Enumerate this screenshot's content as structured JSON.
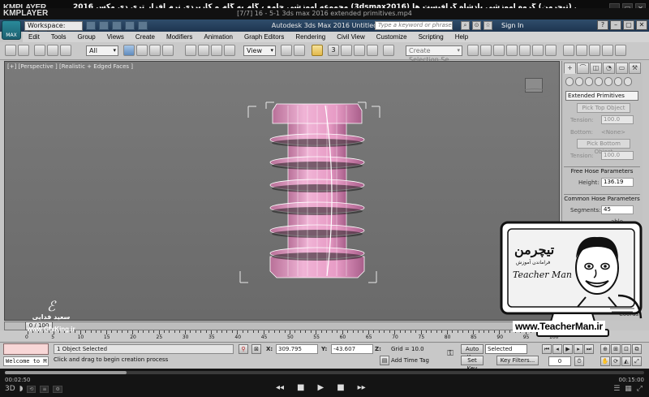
{
  "kmplayer": {
    "logo": "KMPLAYER",
    "logo2": "KMPLAYER",
    "title": "مجموعه آموزشی جامع ، گام به گام و کاربردی نرم افزار تری دی مکس 2016 (3dsmax2016) مدرس : سعید فدایی (تیچرمن) گروه آموزشی پادشاه گرافیست ها",
    "filename": "[7/7] 16 - 5-1 3ds max 2016 extended primitives.mp4",
    "time_current": "00:02:50",
    "time_total": "00:15:00",
    "seek_fraction": 0.19
  },
  "max": {
    "app_button": "MAX",
    "workspace": "Workspace: Default",
    "title": "Autodesk 3ds Max 2016    Untitled",
    "search_placeholder": "Type a keyword or phrase",
    "signin": "Sign In",
    "menu": [
      "Edit",
      "Tools",
      "Group",
      "Views",
      "Create",
      "Modifiers",
      "Animation",
      "Graph Editors",
      "Rendering",
      "Civil View",
      "Customize",
      "Scripting",
      "Help"
    ],
    "selection_filter": "All",
    "ref_coord": "View",
    "selection_set_placeholder": "Create Selection Se",
    "snap_label": "3",
    "viewport_label": "[+] [Perspective ] [Realistic + Edged Faces ]"
  },
  "command_panel": {
    "tabs": [
      "+",
      "⌒",
      "◫",
      "◔",
      "▭",
      "⚒"
    ],
    "category": "Extended Primitives",
    "pick_top": "Pick Top Object",
    "tension1_label": "Tension:",
    "tension1_value": "100.0",
    "bottom_label": "Bottom:",
    "bottom_value": "<None>",
    "pick_bottom": "Pick Bottom Object",
    "tension2_label": "Tension:",
    "tension2_value": "100.0",
    "free_hose_title": "Free Hose Parameters",
    "height_label": "Height:",
    "height_value": "136.19",
    "common_hose_title": "Common Hose Parameters",
    "segments_label": "Segments:",
    "segments_value": "45",
    "flex_label": "able",
    "coords_label": "Coords"
  },
  "timebar": {
    "slider": "0 / 100",
    "ticks": [
      "0",
      "5",
      "10",
      "15",
      "20",
      "25",
      "30",
      "35",
      "40",
      "45",
      "50",
      "55",
      "60",
      "65",
      "70",
      "75",
      "80",
      "85",
      "90",
      "95",
      "100"
    ]
  },
  "status": {
    "welcome": "Welcome to M",
    "selected": "1 Object Selected",
    "prompt": "Click and drag to begin creation process",
    "x_label": "X:",
    "x_value": "309.795",
    "y_label": "Y:",
    "y_value": "-43.607",
    "z_label": "Z:",
    "z_value": "0.0",
    "grid": "Grid = 10.0",
    "add_time_tag": "Add Time Tag",
    "auto_key": "Auto Key",
    "set_key": "Set Key",
    "selected_dd": "Selected",
    "key_filters": "Key Filters...",
    "frame": "0"
  },
  "watermark": {
    "signature": "ℰ",
    "name": "سعید فدایی",
    "site_left": "www.GfxKing.ir",
    "site_right": "www.TeacherMan.ir",
    "badge_fa": "تیچرمن",
    "badge_sub": "فراماندن آموزش",
    "badge_en": "Teacher Man"
  },
  "colors": {
    "object_fill": "#e8a0c8",
    "object_edge": "#ffffff",
    "viewport_bg": "#707070",
    "title_bar": "#2a4560"
  }
}
